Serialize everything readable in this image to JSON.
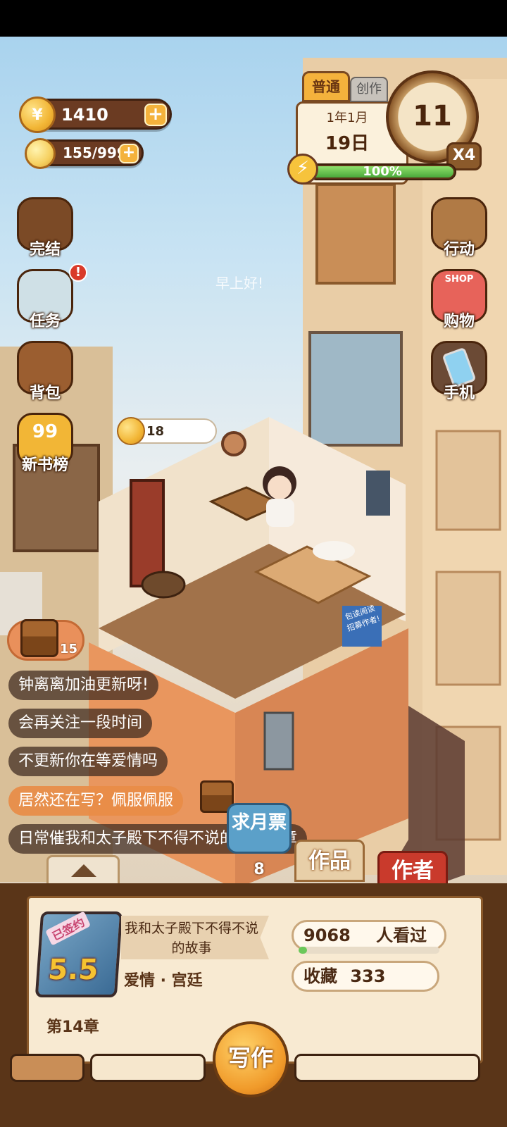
{
  "hud": {
    "coins": "1410",
    "bulbs": "155/999",
    "mode_tab": "普通",
    "mode_tab_2": "创作",
    "date_month": "1年1月",
    "date_day": "19日",
    "clock_hour": "11",
    "speed": "X4",
    "energy_label": "100%",
    "energy_fraction": 1.0
  },
  "side_menu_left": [
    {
      "label": "完结",
      "icon": "book-icon"
    },
    {
      "label": "任务",
      "icon": "clipboard-icon"
    },
    {
      "label": "背包",
      "icon": "bag-icon"
    },
    {
      "label": "新书榜",
      "icon": "ranking-coin-icon",
      "badge_text": "99"
    }
  ],
  "side_menu_right": [
    {
      "label": "行动",
      "icon": "door-icon"
    },
    {
      "label": "购物",
      "icon": "shop-icon",
      "sign": "SHOP"
    },
    {
      "label": "手机",
      "icon": "phone-icon"
    }
  ],
  "scene": {
    "coin_bubble": "18",
    "greeting": "早上好!",
    "poster_text": "包读阅读 招募作者!"
  },
  "chest_count": "15",
  "chat_messages": [
    {
      "text": "钟离离加油更新呀!",
      "highlight": false
    },
    {
      "text": "会再关注一段时间",
      "highlight": false
    },
    {
      "text": "不更新你在等爱情吗",
      "highlight": false
    },
    {
      "text": "居然还在写？佩服佩服",
      "highlight": true
    },
    {
      "text": "日常催我和太子殿下不得不说的故事新章",
      "highlight": false
    }
  ],
  "rank_button": {
    "label": "求月票",
    "count": "8"
  },
  "tabs": {
    "works": "作品",
    "author": "作者"
  },
  "book": {
    "signed_tag": "已签约",
    "score": "5.5",
    "title": "我和太子殿下不得不说的故事",
    "genre": "爱情 · 宫廷",
    "chapter": "第14章",
    "views_count": "9068",
    "views_label": "人看过",
    "views_fraction": 0.06,
    "favorites_label": "收藏",
    "favorites_count": "333"
  },
  "write_button": "写作",
  "colors": {
    "accent": "#f4b23c",
    "wood": "#6b3b22",
    "author_tab": "#c93a2c",
    "energy": "#4aa83a"
  }
}
